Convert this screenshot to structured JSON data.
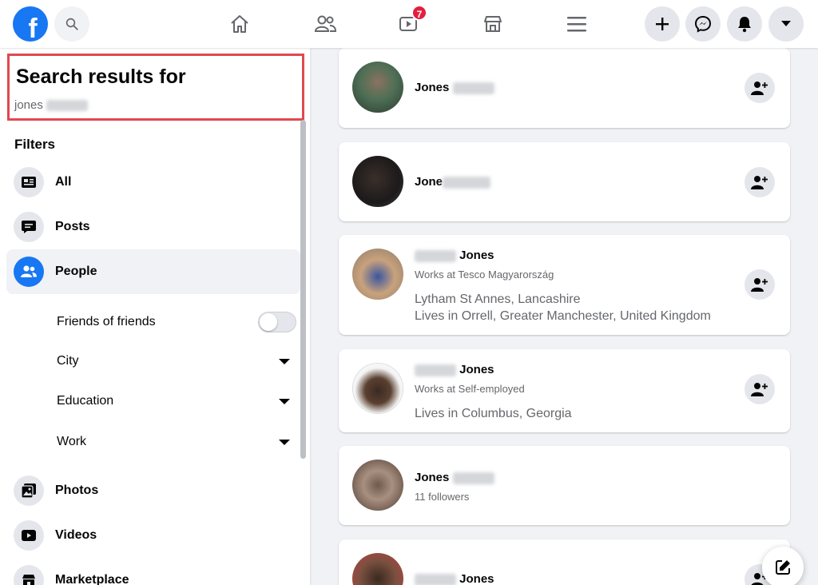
{
  "topbar": {
    "logo_letter": "f",
    "watch_badge": "7"
  },
  "search": {
    "title": "Search results for",
    "term": "jones"
  },
  "filters": {
    "heading": "Filters",
    "items": [
      {
        "label": "All",
        "icon": "feed-icon"
      },
      {
        "label": "Posts",
        "icon": "posts-icon"
      },
      {
        "label": "People",
        "icon": "people-icon",
        "active": true
      },
      {
        "label": "Photos",
        "icon": "photos-icon"
      },
      {
        "label": "Videos",
        "icon": "videos-icon"
      },
      {
        "label": "Marketplace",
        "icon": "marketplace-icon"
      }
    ],
    "people_sub": [
      {
        "label": "Friends of friends",
        "control": "toggle",
        "value": "off"
      },
      {
        "label": "City",
        "control": "dropdown"
      },
      {
        "label": "Education",
        "control": "dropdown"
      },
      {
        "label": "Work",
        "control": "dropdown"
      }
    ]
  },
  "results": [
    {
      "name": "Jones",
      "add_friend": true
    },
    {
      "name": "Jone",
      "add_friend": true
    },
    {
      "name": "Jones",
      "subtitle": "Works at Tesco Magyarország",
      "line1": "Lytham St Annes, Lancashire",
      "line2": "Lives in Orrell, Greater Manchester, United Kingdom",
      "add_friend": true
    },
    {
      "name": "Jones",
      "subtitle": "Works at Self-employed",
      "line1": "Lives in Columbus, Georgia",
      "add_friend": true
    },
    {
      "name": "Jones",
      "subtitle": "11 followers",
      "add_friend": false
    },
    {
      "name": "Jones",
      "add_friend": true
    }
  ],
  "colors": {
    "brand": "#1877f2",
    "badge": "#e41e3f",
    "highlight_border": "#e0484f"
  }
}
